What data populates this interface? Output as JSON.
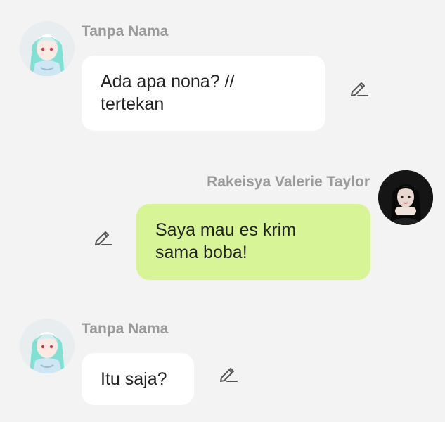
{
  "messages": [
    {
      "sender": "Tanpa Nama",
      "text_lines": [
        "Ada apa nona? //",
        "tertekan"
      ],
      "edit_icon": "pencil-icon"
    },
    {
      "sender": "Rakeisya Valerie Taylor",
      "text_lines": [
        "Saya mau es krim",
        "sama boba!"
      ],
      "edit_icon": "pencil-icon"
    },
    {
      "sender": "Tanpa Nama",
      "text_lines": [
        "Itu saja?"
      ],
      "edit_icon": "pencil-icon"
    }
  ],
  "colors": {
    "background": "#f3f3f3",
    "incoming_bubble": "#ffffff",
    "outgoing_bubble": "#d7f596",
    "sender_name": "#9a9a9a",
    "icon": "#555555"
  }
}
